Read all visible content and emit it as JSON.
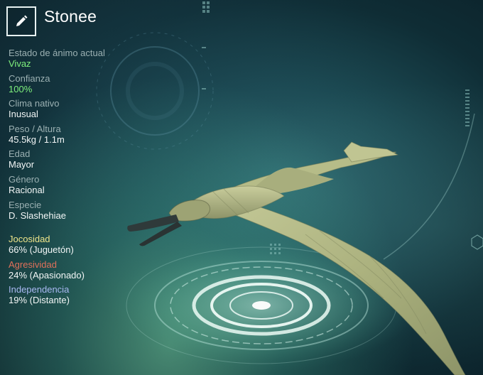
{
  "header": {
    "edit_icon": "pencil-icon",
    "name": "Stonee"
  },
  "stats": [
    {
      "label": "Estado de ánimo actual",
      "value": "Vivaz",
      "value_color": "#7ff07d"
    },
    {
      "label": "Confianza",
      "value": "100%",
      "value_color": "#7ff07d"
    },
    {
      "label": "Clima nativo",
      "value": "Inusual"
    },
    {
      "label": "Peso / Altura",
      "value": "45.5kg / 1.1m"
    },
    {
      "label": "Edad",
      "value": "Mayor"
    },
    {
      "label": "Género",
      "value": "Racional"
    },
    {
      "label": "Especie",
      "value": "D. Slashehiae"
    }
  ],
  "traits": [
    {
      "label": "Jocosidad",
      "value": "66% (Juguetón)",
      "label_color": "#eee58a"
    },
    {
      "label": "Agresividad",
      "value": "24% (Apasionado)",
      "label_color": "#e0705a"
    },
    {
      "label": "Independencia",
      "value": "19% (Distante)",
      "label_color": "#a9b8f2"
    }
  ],
  "colors": {
    "positive": "#7ff07d",
    "label_muted": "#9bb0b2",
    "creature_skin": "#b9bf8c"
  }
}
